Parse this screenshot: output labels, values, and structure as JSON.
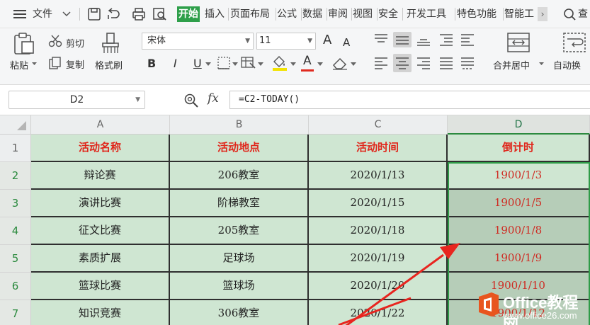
{
  "menubar": {
    "file_label": "文件",
    "tabs": [
      "开始",
      "插入",
      "页面布局",
      "公式",
      "数据",
      "审阅",
      "视图",
      "安全",
      "开发工具",
      "特色功能",
      "智能工"
    ],
    "active_tab": "开始",
    "more_label": "›",
    "search_label": "查"
  },
  "ribbon": {
    "paste_label": "粘贴",
    "cut_label": "剪切",
    "copy_label": "复制",
    "format_painter_label": "格式刷",
    "font_name": "宋体",
    "font_size": "11",
    "merge_label": "合并居中",
    "autowrap_label": "自动换",
    "bold_label": "B",
    "italic_label": "I",
    "underline_label": "U",
    "grow_font_label": "A",
    "shrink_font_label": "A",
    "font_color_label": "A"
  },
  "formula_bar": {
    "name_box": "D2",
    "fx_label": "fx",
    "formula": "=C2-TODAY()"
  },
  "sheet": {
    "columns": [
      "A",
      "B",
      "C",
      "D"
    ],
    "row_numbers": [
      "1",
      "2",
      "3",
      "4",
      "5",
      "6",
      "7"
    ],
    "header": [
      "活动名称",
      "活动地点",
      "活动时间",
      "倒计时"
    ],
    "rows": [
      [
        "辩论赛",
        "206教室",
        "2020/1/13",
        "1900/1/3"
      ],
      [
        "演讲比赛",
        "阶梯教室",
        "2020/1/15",
        "1900/1/5"
      ],
      [
        "征文比赛",
        "205教室",
        "2020/1/18",
        "1900/1/8"
      ],
      [
        "素质扩展",
        "足球场",
        "2020/1/19",
        "1900/1/9"
      ],
      [
        "篮球比赛",
        "篮球场",
        "2020/1/20",
        "1900/1/10"
      ],
      [
        "知识竞赛",
        "306教室",
        "2020/1/22",
        "1900/1/12"
      ]
    ],
    "selected_cell": "D2"
  },
  "watermark": {
    "title": "Office教程网",
    "url": "www.office26.com"
  },
  "colors": {
    "accent": "#2e9f4a",
    "cell_fill": "#cfe6d2",
    "header_text": "#e0261b",
    "arrow": "#e8251f"
  }
}
